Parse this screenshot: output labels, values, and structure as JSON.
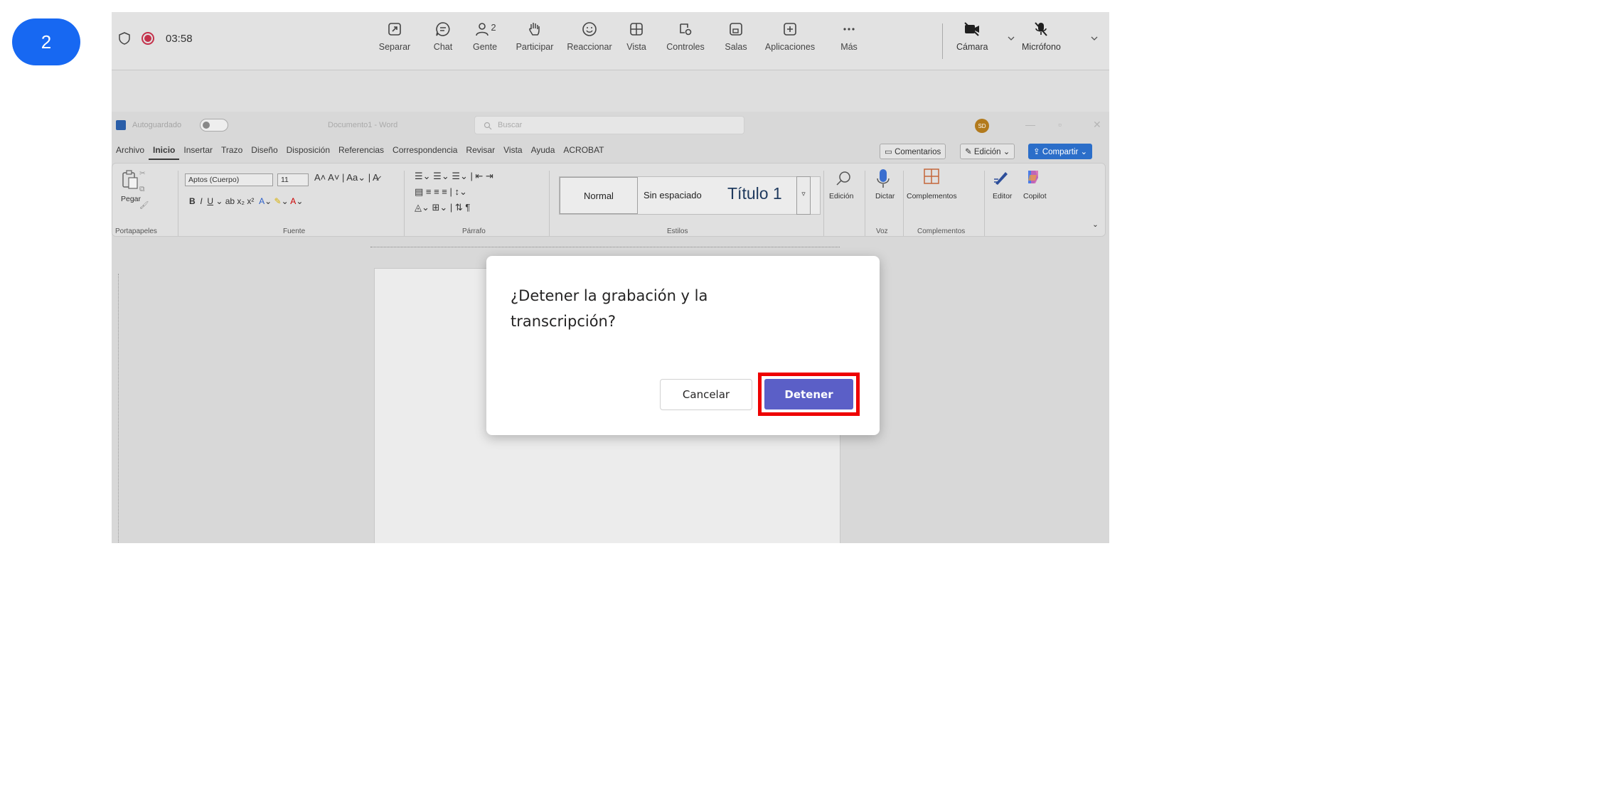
{
  "step": {
    "number": "2"
  },
  "teams_bar": {
    "timer": "03:58",
    "items": [
      {
        "label": "Separar",
        "icon": "pop-out-icon"
      },
      {
        "label": "Chat",
        "icon": "chat-icon"
      },
      {
        "label": "Gente",
        "icon": "people-icon",
        "count": "2"
      },
      {
        "label": "Participar",
        "icon": "raise-hand-icon"
      },
      {
        "label": "Reaccionar",
        "icon": "smiley-icon"
      },
      {
        "label": "Vista",
        "icon": "grid-view-icon"
      },
      {
        "label": "Controles",
        "icon": "controls-icon"
      },
      {
        "label": "Salas",
        "icon": "rooms-icon"
      },
      {
        "label": "Aplicaciones",
        "icon": "add-apps-icon"
      },
      {
        "label": "Más",
        "icon": "more-icon"
      }
    ],
    "camera_label": "Cámara",
    "mic_label": "Micrófono"
  },
  "word": {
    "autosave_label": "Autoguardado",
    "doc_name": "Documento1 - Word",
    "search_placeholder": "Buscar",
    "user_initials": "SD",
    "menu": [
      "Archivo",
      "Inicio",
      "Insertar",
      "Trazo",
      "Diseño",
      "Disposición",
      "Referencias",
      "Correspondencia",
      "Revisar",
      "Vista",
      "Ayuda",
      "ACROBAT"
    ],
    "active_menu": "Inicio",
    "comments_label": "Comentarios",
    "editing_label": "Edición",
    "share_label": "Compartir",
    "ribbon": {
      "paste_label": "Pegar",
      "font_name": "Aptos (Cuerpo)",
      "font_size": "11",
      "styles": {
        "normal": "Normal",
        "no_spacing": "Sin espaciado",
        "title1": "Título 1"
      },
      "editing_btn": "Edición",
      "dictate_btn": "Dictar",
      "addins_btn": "Complementos",
      "editor_btn": "Editor",
      "copilot_btn": "Copilot",
      "groups": {
        "clipboard": "Portapapeles",
        "font": "Fuente",
        "paragraph": "Párrafo",
        "styles": "Estilos",
        "voice": "Voz",
        "addins": "Complementos"
      }
    }
  },
  "dialog": {
    "title": "¿Detener la grabación y la transcripción?",
    "cancel_label": "Cancelar",
    "stop_label": "Detener"
  },
  "colors": {
    "step_badge": "#1768f2",
    "stop_button": "#5b5fc7",
    "highlight": "#ee0000",
    "record": "#c4314b"
  }
}
